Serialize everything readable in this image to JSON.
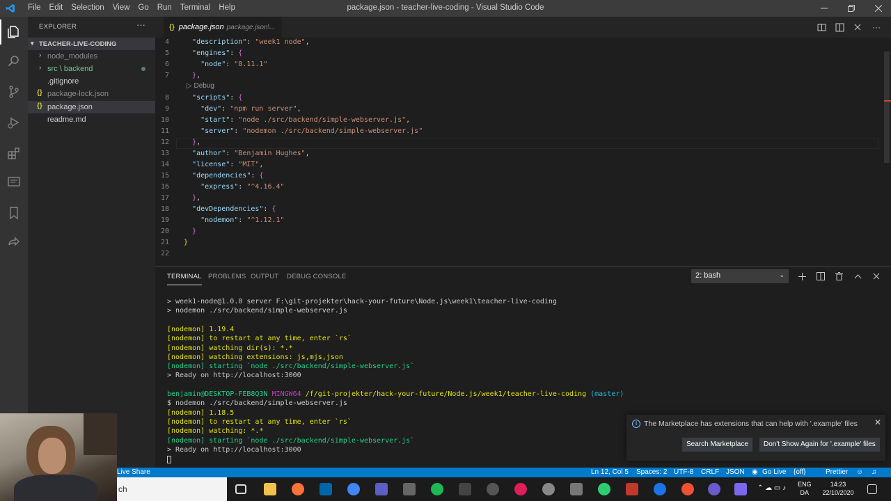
{
  "window": {
    "title": "package.json - teacher-live-coding - Visual Studio Code",
    "menu": [
      "File",
      "Edit",
      "Selection",
      "View",
      "Go",
      "Run",
      "Terminal",
      "Help"
    ]
  },
  "activity_bar": {
    "icons": [
      "explorer-icon",
      "search-icon",
      "source-control-icon",
      "run-debug-icon",
      "extensions-icon",
      "remote-explorer-icon",
      "bookmarks-icon",
      "live-share-icon"
    ]
  },
  "sidebar": {
    "header": "EXPLORER",
    "more": "···",
    "folder": "TEACHER-LIVE-CODING",
    "items": [
      {
        "label": "node_modules",
        "type": "folder"
      },
      {
        "label": "src \\ backend",
        "type": "folder"
      },
      {
        "label": ".gitignore",
        "type": "file"
      },
      {
        "label": "package-lock.json",
        "type": "json"
      },
      {
        "label": "package.json",
        "type": "json"
      },
      {
        "label": "readme.md",
        "type": "file"
      }
    ]
  },
  "tab": {
    "icon": "{}",
    "name": "package.json",
    "description": "package.json\\..."
  },
  "editor": {
    "codelens": "Debug",
    "lines": [
      {
        "n": "4",
        "code": "  \"description\": \"week1 node\","
      },
      {
        "n": "5",
        "code": "  \"engines\": {"
      },
      {
        "n": "6",
        "code": "    \"node\": \"8.11.1\""
      },
      {
        "n": "7",
        "code": "  },"
      },
      {
        "n": "8",
        "code": "  \"scripts\": {"
      },
      {
        "n": "9",
        "code": "    \"dev\": \"npm run server\","
      },
      {
        "n": "10",
        "code": "    \"start\": \"node ./src/backend/simple-webserver.js\","
      },
      {
        "n": "11",
        "code": "    \"server\": \"nodemon ./src/backend/simple-webserver.js\""
      },
      {
        "n": "12",
        "code": "  },"
      },
      {
        "n": "13",
        "code": "  \"author\": \"Benjamin Hughes\","
      },
      {
        "n": "14",
        "code": "  \"license\": \"MIT\","
      },
      {
        "n": "15",
        "code": "  \"dependencies\": {"
      },
      {
        "n": "16",
        "code": "    \"express\": \"^4.16.4\""
      },
      {
        "n": "17",
        "code": "  },"
      },
      {
        "n": "18",
        "code": "  \"devDependencies\": {"
      },
      {
        "n": "19",
        "code": "    \"nodemon\": \"^1.12.1\""
      },
      {
        "n": "20",
        "code": "  }"
      },
      {
        "n": "21",
        "code": "}"
      },
      {
        "n": "22",
        "code": ""
      }
    ]
  },
  "panel": {
    "tabs": [
      "TERMINAL",
      "PROBLEMS",
      "OUTPUT",
      "DEBUG CONSOLE"
    ],
    "shell": "2: bash",
    "terminal_lines": [
      {
        "text": "> week1-node@1.0.0 server F:\\git-projekter\\hack-your-future\\Node.js\\week1\\teacher-live-coding",
        "color": "plain"
      },
      {
        "text": "> nodemon ./src/backend/simple-webserver.js",
        "color": "plain"
      },
      {
        "text": "",
        "color": "plain"
      },
      {
        "text": "[nodemon] 1.19.4",
        "color": "yellow"
      },
      {
        "text": "[nodemon] to restart at any time, enter `rs`",
        "color": "yellow"
      },
      {
        "text": "[nodemon] watching dir(s): *.*",
        "color": "yellow"
      },
      {
        "text": "[nodemon] watching extensions: js,mjs,json",
        "color": "yellow"
      },
      {
        "text": "[nodemon] starting `node ./src/backend/simple-webserver.js`",
        "color": "green"
      },
      {
        "text": "> Ready on http://localhost:3000",
        "color": "plain"
      },
      {
        "text": "",
        "color": "plain"
      },
      {
        "text": "PROMPT",
        "color": "prompt"
      },
      {
        "text": "$ nodemon ./src/backend/simple-webserver.js",
        "color": "plain"
      },
      {
        "text": "[nodemon] 1.18.5",
        "color": "yellow"
      },
      {
        "text": "[nodemon] to restart at any time, enter `rs`",
        "color": "yellow"
      },
      {
        "text": "[nodemon] watching: *.*",
        "color": "yellow"
      },
      {
        "text": "[nodemon] starting `node ./src/backend/simple-webserver.js`",
        "color": "green"
      },
      {
        "text": "> Ready on http://localhost:3000",
        "color": "plain"
      }
    ],
    "prompt": {
      "user": "benjamin@DESKTOP-FEB8Q3N",
      "shell": "MINGW64",
      "path": "/f/git-projekter/hack-your-future/Node.js/week1/teacher-live-coding",
      "branch": "(master)"
    }
  },
  "notification": {
    "message": "The Marketplace has extensions that can help with '.example' files",
    "buttons": [
      "Search Marketplace",
      "Don't Show Again for '.example' files"
    ]
  },
  "statusbar": {
    "live_share": "Live Share",
    "position": "Ln 12, Col 5",
    "spaces": "Spaces: 2",
    "encoding": "UTF-8",
    "eol": "CRLF",
    "language": "JSON",
    "go_live": "Go Live",
    "off": "{off}",
    "prettier": "Prettier"
  },
  "taskbar": {
    "search_text": "ch",
    "lang_top": "ENG",
    "lang_bottom": "DA",
    "time": "14:23",
    "date": "22/10/2020"
  },
  "colors": {
    "statusbar": "#007acc",
    "accent": "#75beff"
  }
}
